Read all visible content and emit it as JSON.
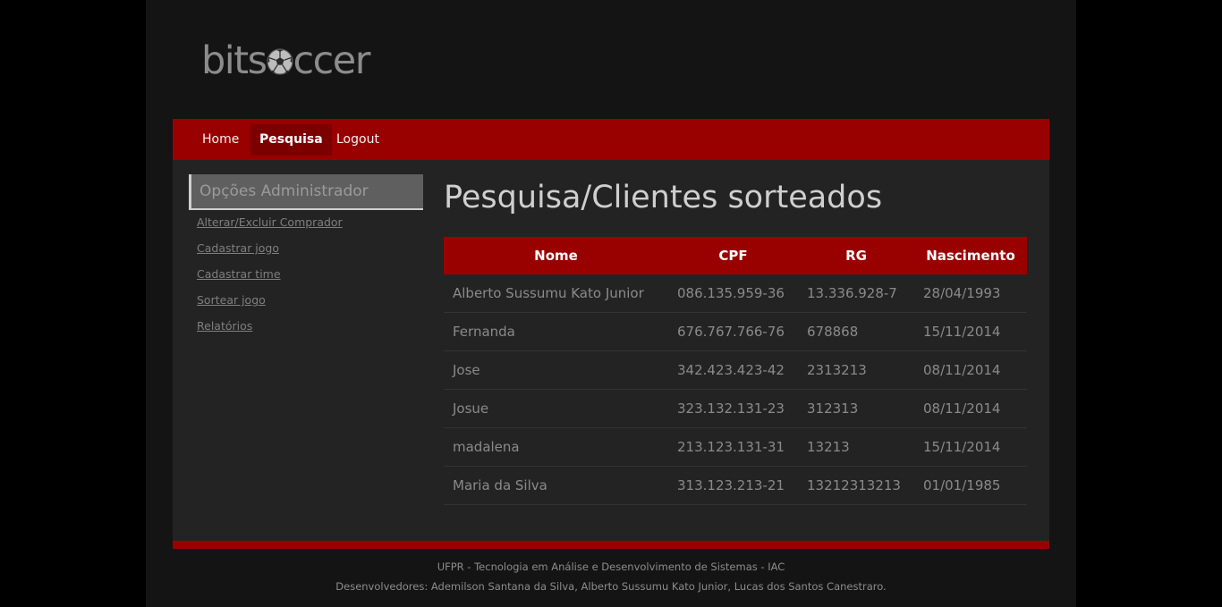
{
  "header": {
    "logo_left": "bits",
    "logo_right": "ccer"
  },
  "nav": {
    "items": [
      {
        "label": "Home",
        "active": false
      },
      {
        "label": "Pesquisa",
        "active": true
      },
      {
        "label": "Logout",
        "active": false
      }
    ]
  },
  "sidebar": {
    "title": "Opções Administrador",
    "links": [
      "Alterar/Excluir Comprador",
      "Cadastrar jogo",
      "Cadastrar time",
      "Sortear jogo",
      "Relatórios"
    ]
  },
  "main": {
    "title": "Pesquisa/Clientes sorteados",
    "columns": [
      "Nome",
      "CPF",
      "RG",
      "Nascimento"
    ],
    "rows": [
      [
        "Alberto Sussumu Kato Junior",
        "086.135.959-36",
        "13.336.928-7",
        "28/04/1993"
      ],
      [
        "Fernanda",
        "676.767.766-76",
        "678868",
        "15/11/2014"
      ],
      [
        "Jose",
        "342.423.423-42",
        "2313213",
        "08/11/2014"
      ],
      [
        "Josue",
        "323.132.131-23",
        "312313",
        "08/11/2014"
      ],
      [
        "madalena",
        "213.123.131-31",
        "13213",
        "15/11/2014"
      ],
      [
        "Maria da Silva",
        "313.123.213-21",
        "13212313213",
        "01/01/1985"
      ]
    ]
  },
  "footer": {
    "line1": "UFPR - Tecnologia em Análise e Desenvolvimento de Sistemas - IAC",
    "line2": "Desenvolvedores: Ademilson Santana da Silva, Alberto Sussumu Kato Junior, Lucas dos Santos Canestraro."
  },
  "colors": {
    "accent": "#990000",
    "accent_dark": "#7d0000",
    "background": "#141414",
    "panel": "#232323"
  },
  "icons": {
    "logo_ball": "soccer-ball-icon"
  }
}
